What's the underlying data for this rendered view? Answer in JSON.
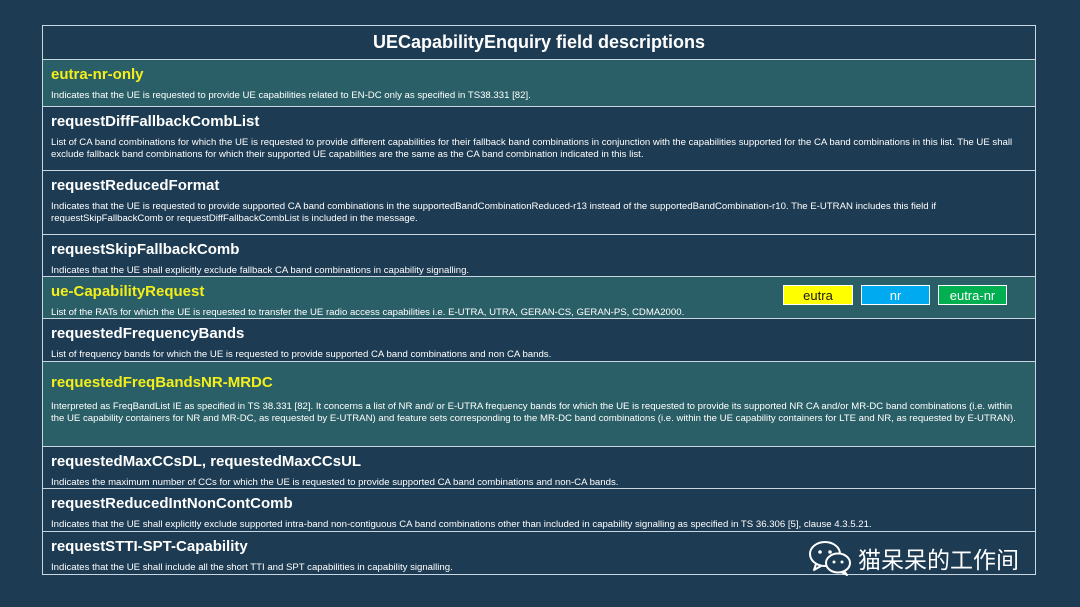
{
  "title": "UECapabilityEnquiry field descriptions",
  "rows": [
    {
      "name": "eutra-nr-only",
      "description": "Indicates that the UE is requested to provide UE capabilities related to EN-DC only as specified in TS38.331 [82]."
    },
    {
      "name": "requestDiffFallbackCombList",
      "description": "List of CA band combinations for which the UE is requested to provide different capabilities for their fallback band combinations in conjunction with the capabilities supported for the CA band combinations in this list. The UE shall exclude fallback band combinations for which their supported UE capabilities are the same as the CA band combination indicated in this list."
    },
    {
      "name": "requestReducedFormat",
      "description": "Indicates that the UE is requested to provide supported CA band combinations in the supportedBandCombinationReduced-r13 instead of the supportedBandCombination-r10. The E-UTRAN includes this field if requestSkipFallbackComb or requestDiffFallbackCombList is included in the message."
    },
    {
      "name": "requestSkipFallbackComb",
      "description": "Indicates that the UE shall explicitly exclude fallback CA band combinations in capability signalling."
    },
    {
      "name": "ue-CapabilityRequest",
      "description": "List of the RATs for which the UE is requested to transfer the UE radio access capabilities i.e. E-UTRA, UTRA, GERAN-CS, GERAN-PS, CDMA2000."
    },
    {
      "name": "requestedFrequencyBands",
      "description": "List of frequency bands for which the UE is requested to provide supported CA band combinations and non CA bands."
    },
    {
      "name": "requestedFreqBandsNR-MRDC",
      "description": "Interpreted as FreqBandList IE as specified in TS 38.331 [82]. It concerns a list of NR and/ or E-UTRA frequency bands for which the UE is requested to provide its supported NR CA and/or MR-DC band combinations (i.e. within the UE capability containers for NR and MR-DC, as requested by E-UTRAN) and feature sets corresponding to the MR-DC band combinations (i.e. within the UE capability containers for LTE and NR, as requested by E-UTRAN)."
    },
    {
      "name": "requestedMaxCCsDL, requestedMaxCCsUL",
      "description": "Indicates the maximum number of CCs for which the UE is requested to provide supported CA band combinations and non-CA bands."
    },
    {
      "name": "requestReducedIntNonContComb",
      "description": "Indicates that the UE shall explicitly exclude supported intra-band non-contiguous CA band combinations other than included in capability signalling as specified in TS 36.306 [5], clause 4.3.5.21."
    },
    {
      "name": "requestSTTI-SPT-Capability",
      "description": "Indicates that the UE shall include all the short TTI and SPT capabilities in capability signalling."
    }
  ],
  "tags": {
    "eutra": "eutra",
    "nr": "nr",
    "eutra_nr": "eutra-nr"
  },
  "colors": {
    "background": "#1d3b52",
    "highlight_row": "#2b5f67",
    "highlight_text": "#f4ef1a",
    "tag_eutra": "#ffff00",
    "tag_nr": "#00aaf0",
    "tag_eutra_nr": "#00b050"
  },
  "watermark": {
    "icon": "wechat-icon",
    "text": "猫呆呆的工作间"
  }
}
